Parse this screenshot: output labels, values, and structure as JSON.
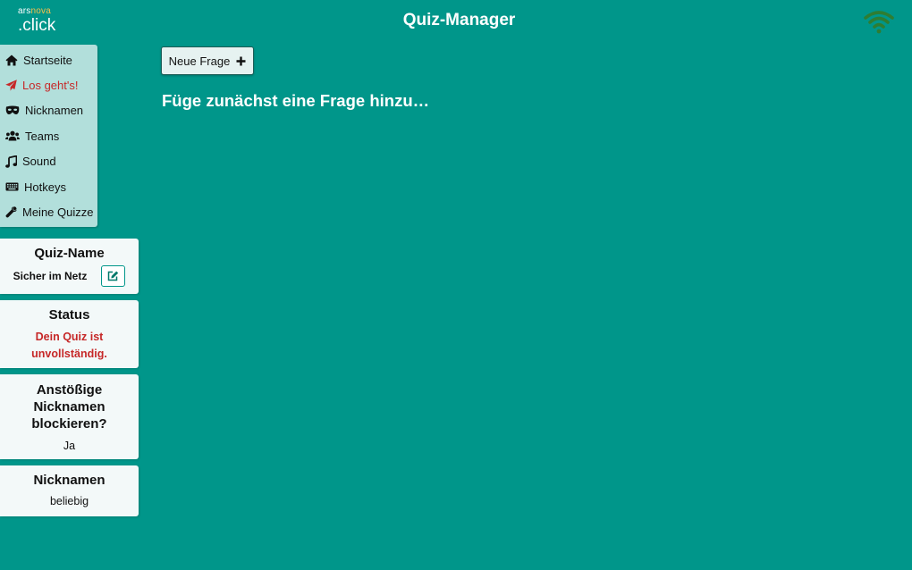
{
  "header": {
    "logo_small_1": "ars",
    "logo_small_2": "nova",
    "logo_big": ".click",
    "title": "Quiz-Manager",
    "connection_icon": "wifi-icon"
  },
  "colors": {
    "background": "#00968a",
    "sidebar": "#b2dfdb",
    "active": "#c62828",
    "wifi": "#2e7d32",
    "logo_accent": "#f5c04a"
  },
  "sidebar": {
    "items": [
      {
        "label": "Startseite",
        "icon": "home-icon"
      },
      {
        "label": "Los geht's!",
        "icon": "paper-plane-icon",
        "active": true
      },
      {
        "label": "Nicknamen",
        "icon": "mask-icon"
      },
      {
        "label": "Teams",
        "icon": "users-icon"
      },
      {
        "label": "Sound",
        "icon": "music-icon"
      },
      {
        "label": "Hotkeys",
        "icon": "keyboard-icon"
      },
      {
        "label": "Meine Quizze",
        "icon": "wrench-icon"
      }
    ]
  },
  "cards": {
    "quiz_name": {
      "title": "Quiz-Name",
      "value": "Sicher im Netz",
      "edit_icon": "edit-icon"
    },
    "status": {
      "title": "Status",
      "line1": "Dein Quiz ist",
      "line2": "unvollständig."
    },
    "block_nicknames": {
      "title1": "Anstößige",
      "title2": "Nicknamen",
      "title3": "blockieren?",
      "value": "Ja"
    },
    "nicknames": {
      "title": "Nicknamen",
      "value": "beliebig"
    }
  },
  "main": {
    "new_question_label": "Neue Frage",
    "new_question_icon": "plus-icon",
    "hint": "Füge zunächst eine Frage hinzu…"
  }
}
